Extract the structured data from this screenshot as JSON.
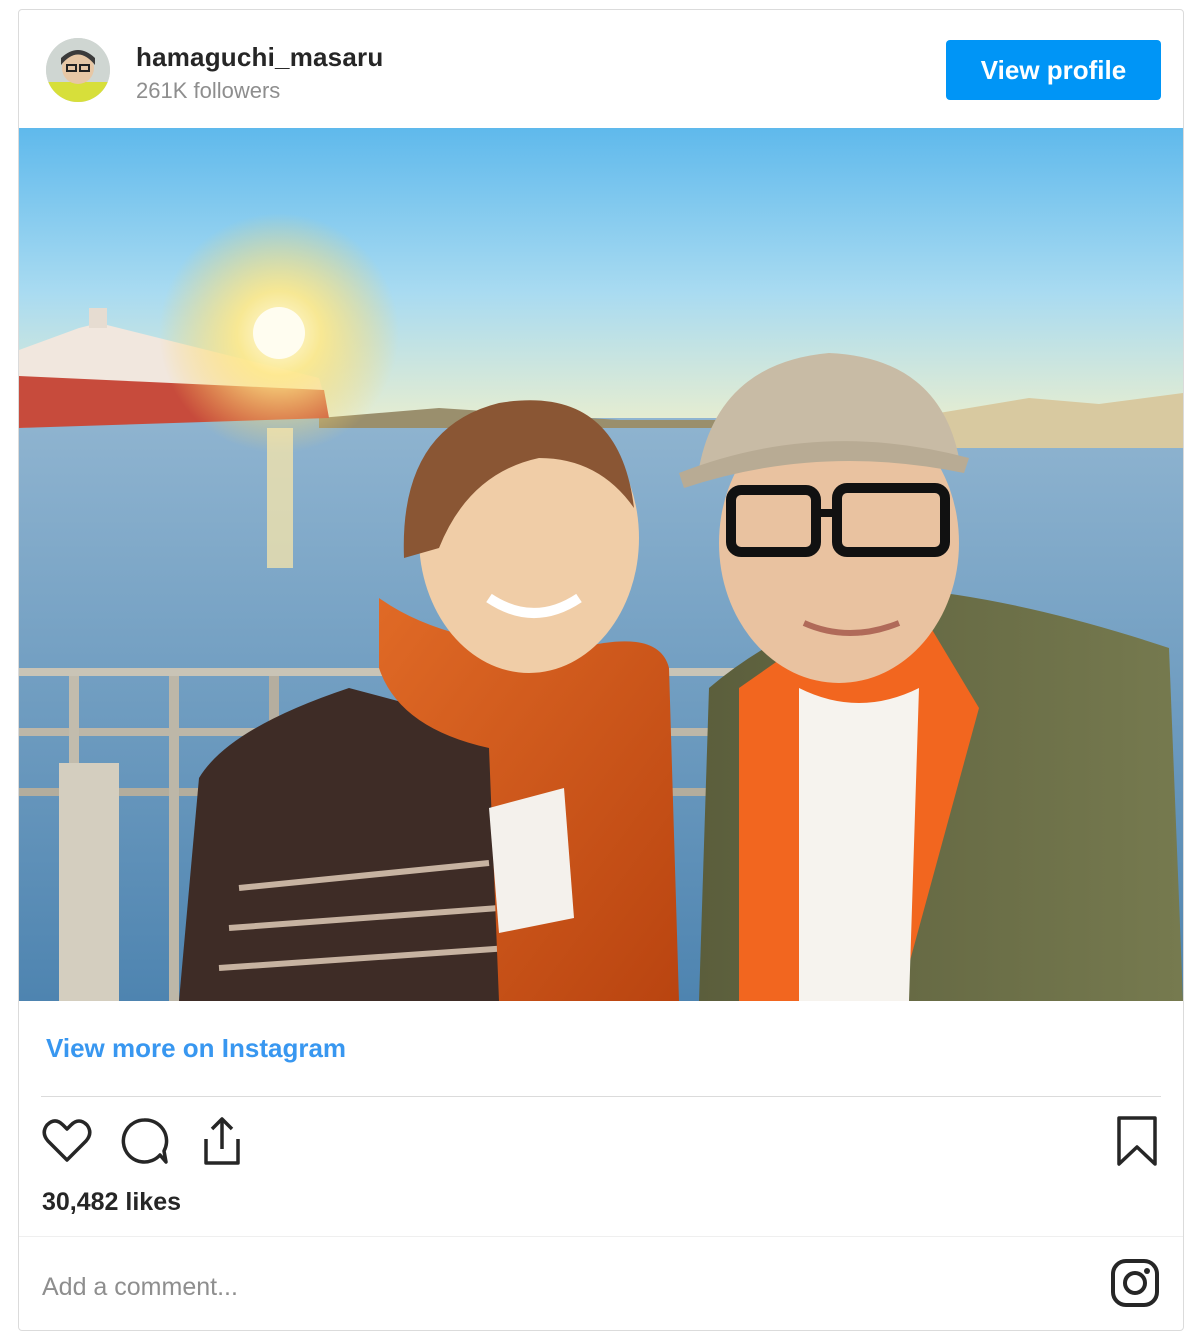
{
  "header": {
    "username": "hamaguchi_masaru",
    "followers": "261K followers",
    "view_profile_label": "View profile",
    "accent_color": "#0095f6"
  },
  "post": {
    "image_icon": "photo-image",
    "view_more_label": "View more on Instagram",
    "likes": "30,482 likes"
  },
  "actions": {
    "like_icon": "heart-icon",
    "comment_icon": "comment-icon",
    "share_icon": "share-icon",
    "save_icon": "bookmark-icon"
  },
  "comment": {
    "placeholder": "Add a comment...",
    "instagram_icon": "instagram-icon"
  }
}
